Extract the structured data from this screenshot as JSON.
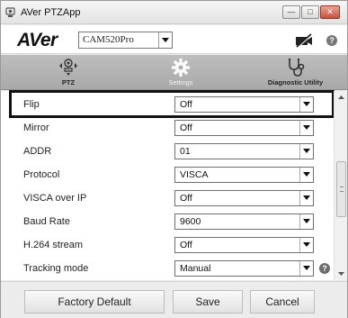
{
  "window": {
    "title": "AVer PTZApp",
    "min_glyph": "—",
    "max_glyph": "□",
    "close_glyph": "✕"
  },
  "brand": {
    "logo": "AVer",
    "camera_model": "CAM520Pro",
    "help_glyph": "?"
  },
  "nav": {
    "items": [
      {
        "id": "ptz",
        "label": "PTZ",
        "icon": "ptz-camera-icon"
      },
      {
        "id": "settings",
        "label": "Settings",
        "icon": "gear-icon",
        "active": true
      },
      {
        "id": "diagnostic",
        "label": "Diagnostic Utility",
        "icon": "stethoscope-icon"
      }
    ]
  },
  "settings": {
    "rows": [
      {
        "label": "Flip",
        "value": "Off"
      },
      {
        "label": "Mirror",
        "value": "Off"
      },
      {
        "label": "ADDR",
        "value": "01"
      },
      {
        "label": "Protocol",
        "value": "VISCA"
      },
      {
        "label": "VISCA over IP",
        "value": "Off"
      },
      {
        "label": "Baud Rate",
        "value": "9600"
      },
      {
        "label": "H.264 stream",
        "value": "Off"
      },
      {
        "label": "Tracking mode",
        "value": "Manual",
        "help": "?"
      }
    ]
  },
  "footer": {
    "factory_default_label": "Factory Default",
    "save_label": "Save",
    "cancel_label": "Cancel"
  },
  "colors": {
    "navbar": "#b3b3b3",
    "highlight": "#111111",
    "window_bg": "#ececec"
  }
}
